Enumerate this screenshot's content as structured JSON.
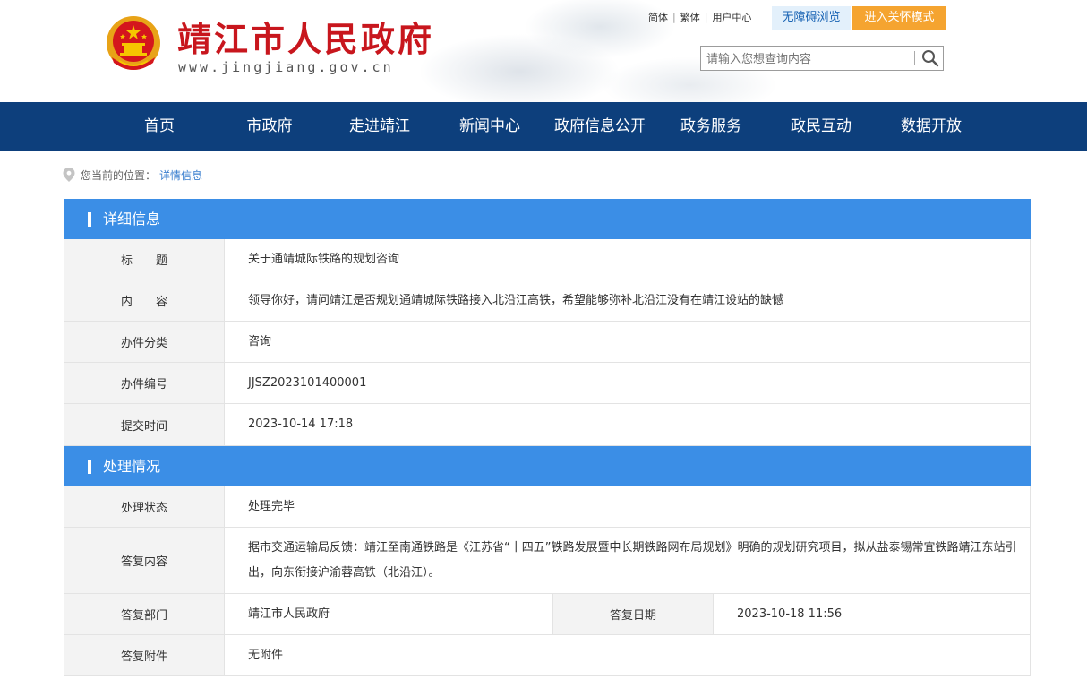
{
  "header": {
    "site_title": "靖江市人民政府",
    "site_url": "www.jingjiang.gov.cn",
    "top_links": [
      "简体",
      "繁体",
      "用户中心"
    ],
    "accessibility_button": "无障碍浏览",
    "care_mode_button": "进入关怀模式",
    "search": {
      "placeholder": "请输入您想查询内容",
      "icon": "search-icon"
    }
  },
  "nav": {
    "items": [
      "首页",
      "市政府",
      "走进靖江",
      "新闻中心",
      "政府信息公开",
      "政务服务",
      "政民互动",
      "数据开放"
    ]
  },
  "breadcrumb": {
    "prefix": "您当前的位置：",
    "current": "详情信息"
  },
  "detail": {
    "section_title": "详细信息",
    "rows": [
      {
        "label": "标　　题",
        "value": "关于通靖城际铁路的规划咨询"
      },
      {
        "label": "内　　容",
        "value": "领导你好，请问靖江是否规划通靖城际铁路接入北沿江高铁，希望能够弥补北沿江没有在靖江设站的缺憾"
      },
      {
        "label": "办件分类",
        "value": "咨询"
      },
      {
        "label": "办件编号",
        "value": "JJSZ2023101400001"
      },
      {
        "label": "提交时间",
        "value": "2023-10-14 17:18"
      }
    ]
  },
  "handling": {
    "section_title": "处理情况",
    "status_label": "处理状态",
    "status_value": "处理完毕",
    "reply_label": "答复内容",
    "reply_value": "据市交通运输局反馈：靖江至南通铁路是《江苏省“十四五”铁路发展暨中长期铁路网布局规划》明确的规划研究项目，拟从盐泰锡常宜铁路靖江东站引出，向东衔接沪渝蓉高铁（北沿江）。",
    "dept_label": "答复部门",
    "dept_value": "靖江市人民政府",
    "date_label": "答复日期",
    "date_value": "2023-10-18 11:56",
    "attachment_label": "答复附件",
    "attachment_value": "无附件"
  },
  "colors": {
    "nav_bg": "#0d3f7c",
    "section_bg": "#3b8ee6",
    "title_red": "#c8161d",
    "care_orange": "#f5a430",
    "access_bg": "#e3f0fb"
  }
}
